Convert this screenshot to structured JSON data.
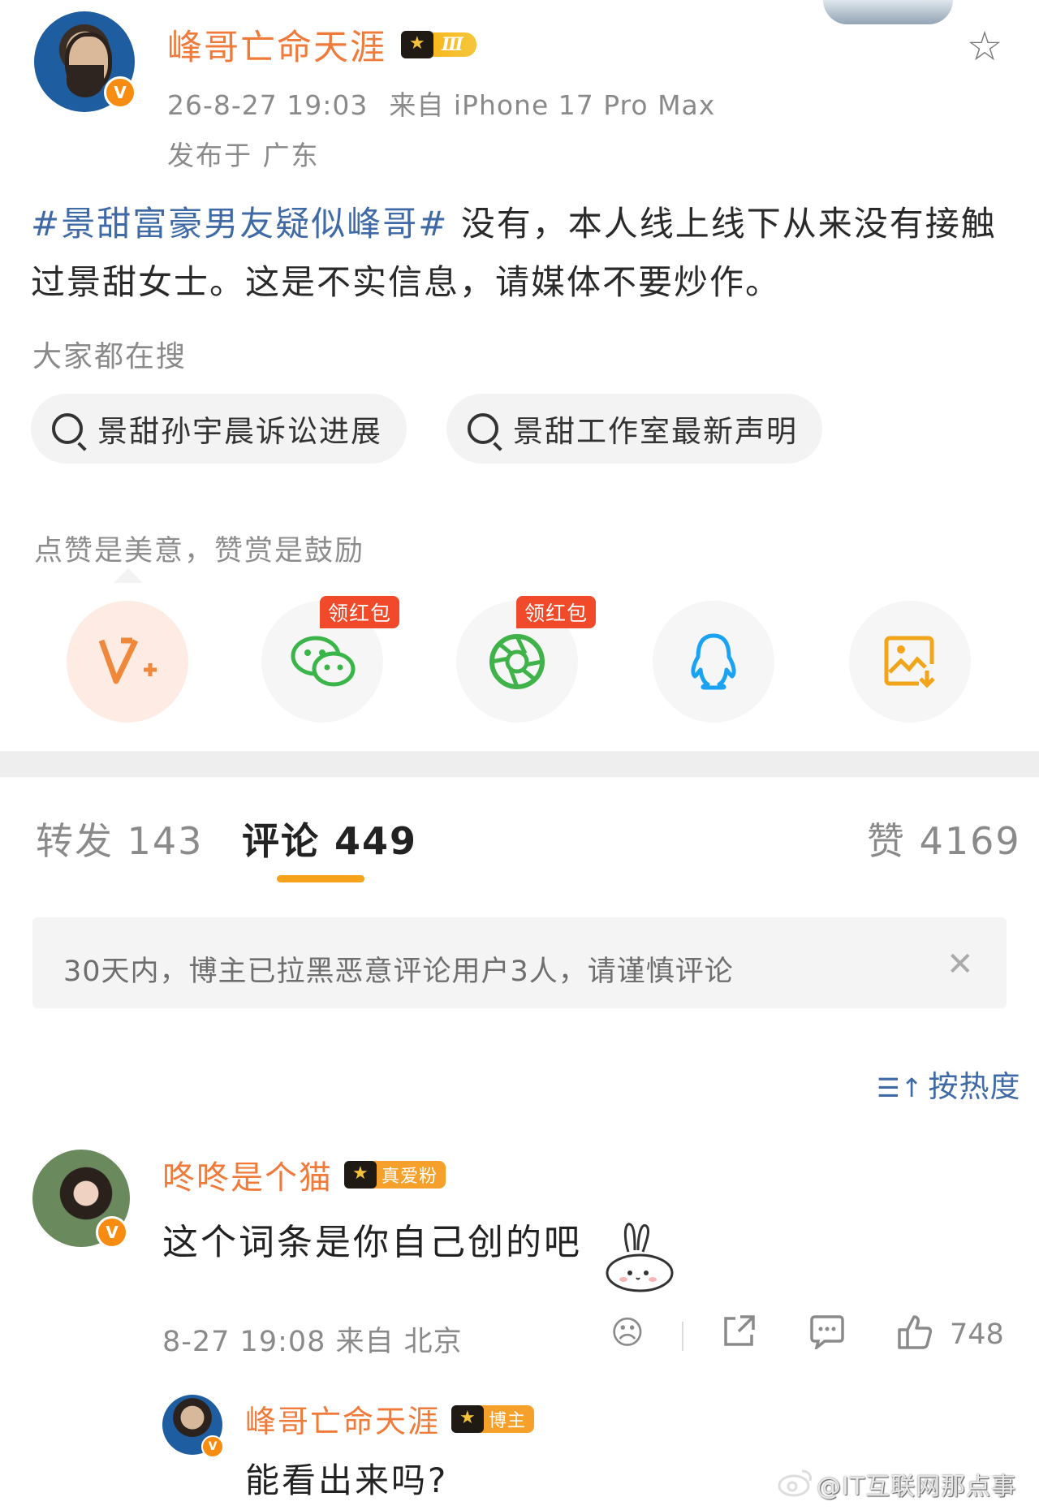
{
  "post": {
    "author_name": "峰哥亡命天涯",
    "vip_level": "Ⅲ",
    "timestamp": "26-8-27 19:03",
    "source": "来自 iPhone 17 Pro Max",
    "location": "发布于 广东",
    "hashtag": "#景甜富豪男友疑似峰哥#",
    "body": " 没有，本人线上线下从来没有接触过景甜女士。这是不实信息，请媒体不要炒作。"
  },
  "search": {
    "label": "大家都在搜",
    "items": [
      "景甜孙宇晨诉讼进展",
      "景甜工作室最新声明"
    ]
  },
  "reward": {
    "label": "点赞是美意，赞赏是鼓励",
    "badge": "领红包",
    "share_icons": [
      "v-plus-icon",
      "wechat-icon",
      "moments-icon",
      "qq-icon",
      "save-image-icon"
    ],
    "colors": {
      "v_plus": "#f0883c",
      "wechat": "#39b54a",
      "moments": "#3fb34a",
      "qq": "#1aa3f2",
      "save": "#f2a51a"
    }
  },
  "tabs": {
    "repost": "转发 143",
    "comments": "评论 449",
    "likes": "赞 4169"
  },
  "notice": {
    "text": "30天内，博主已拉黑恶意评论用户3人，请谨慎评论"
  },
  "sort": {
    "label": "按热度"
  },
  "comment": {
    "author_name": "咚咚是个猫",
    "fan_badge": "真爱粉",
    "text": "这个词条是你自己创的吧",
    "meta": "8-27 19:08 来自 北京",
    "likes": "748"
  },
  "reply": {
    "author_name": "峰哥亡命天涯",
    "badge": "博主",
    "text": "能看出来吗?"
  },
  "watermark": "@IT互联网那点事",
  "colors": {
    "accent_orange": "#f07a3a",
    "link_blue": "#3f6aa6",
    "tab_underline": "#f7a21b",
    "hongbao_red": "#f04a2a"
  }
}
